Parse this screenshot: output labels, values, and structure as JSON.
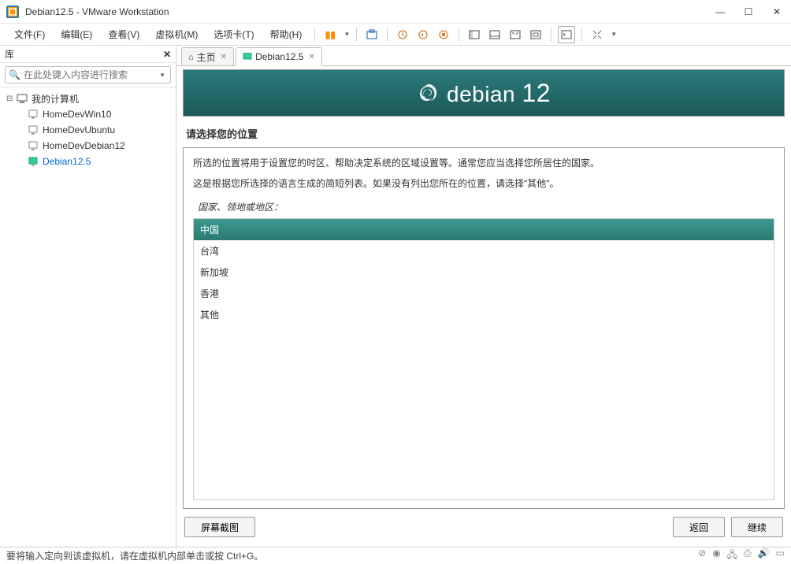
{
  "window": {
    "title": "Debian12.5  - VMware Workstation"
  },
  "menus": {
    "file": "文件(F)",
    "edit": "编辑(E)",
    "view": "查看(V)",
    "vm": "虚拟机(M)",
    "tabs": "选项卡(T)",
    "help": "帮助(H)"
  },
  "sidebar": {
    "title": "库",
    "search_placeholder": "在此处键入内容进行搜索",
    "root": "我的计算机",
    "items": [
      {
        "label": "HomeDevWin10"
      },
      {
        "label": "HomeDevUbuntu"
      },
      {
        "label": "HomeDevDebian12"
      },
      {
        "label": "Debian12.5"
      }
    ]
  },
  "tabs": {
    "home": "主页",
    "vm": "Debian12.5"
  },
  "installer": {
    "brand": "debian",
    "version": "12",
    "heading": "请选择您的位置",
    "text1": "所选的位置将用于设置您的时区、帮助决定系统的区域设置等。通常您应当选择您所居住的国家。",
    "text2": "这是根据您所选择的语言生成的简短列表。如果没有列出您所在的位置，请选择\"其他\"。",
    "label": "国家、领地或地区：",
    "options": [
      "中国",
      "台湾",
      "新加坡",
      "香港",
      "其他"
    ],
    "selected_index": 0,
    "btn_screenshot": "屏幕截图",
    "btn_back": "返回",
    "btn_continue": "继续"
  },
  "status": {
    "text": "要将输入定向到该虚拟机，请在虚拟机内部单击或按 Ctrl+G。"
  }
}
